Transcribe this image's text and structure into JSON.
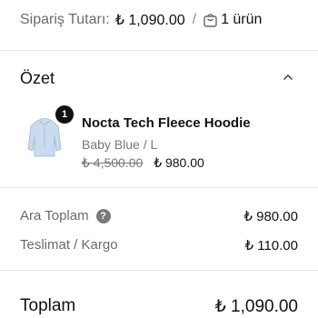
{
  "order_header": {
    "label": "Sipariş Tutarı:",
    "total": "₺ 1,090.00",
    "separator": "/",
    "item_count": "1 ürün",
    "icon": "shopping-bag-icon"
  },
  "summary": {
    "title": "Özet",
    "toggle_icon": "chevron-up-icon"
  },
  "product": {
    "quantity": "1",
    "name": "Nocta Tech Fleece Hoodie",
    "variant": "Baby Blue / L",
    "original_price": "₺ 4,500.00",
    "sale_price": "₺ 980.00",
    "thumbnail_color": "#c9dbee"
  },
  "subtotal": {
    "label": "Ara Toplam",
    "value": "₺ 980.00",
    "icon": "info-icon"
  },
  "shipping": {
    "label": "Teslimat / Kargo",
    "value": "₺ 110.00"
  },
  "total": {
    "label": "Toplam",
    "value": "₺ 1,090.00"
  }
}
